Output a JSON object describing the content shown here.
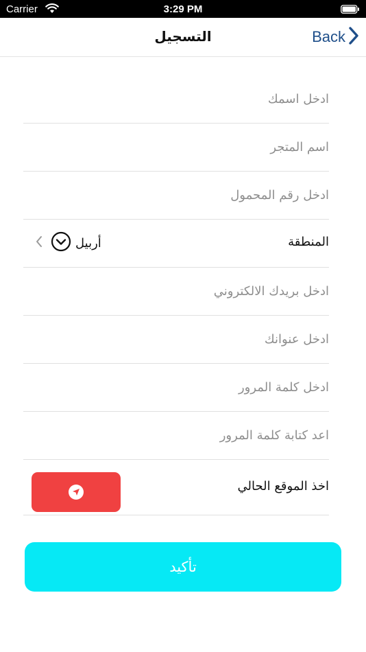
{
  "status_bar": {
    "carrier": "Carrier",
    "time": "3:29 PM",
    "wifi_icon": "wifi-icon",
    "battery_icon": "battery-icon"
  },
  "nav": {
    "title": "التسجيل",
    "back_label": "Back",
    "back_icon": "chevron-right-icon",
    "accent_color": "#1f4f8a"
  },
  "form": {
    "name_placeholder": "ادخل اسمك",
    "store_placeholder": "اسم المتجر",
    "mobile_placeholder": "ادخل رقم المحمول",
    "region": {
      "label": "المنطقة",
      "value": "أربيل",
      "dropdown_icon": "chevron-down-circle-icon",
      "chevron_icon": "chevron-left-icon"
    },
    "email_placeholder": "ادخل بريدك الالكتروني",
    "address_placeholder": "ادخل عنوانك",
    "password_placeholder": "ادخل كلمة المرور",
    "password_confirm_placeholder": "اعد كتابة كلمة المرور",
    "location": {
      "label": "اخذ الموقع الحالي",
      "button_icon": "location-arrow-icon",
      "button_color": "#f04141"
    }
  },
  "confirm": {
    "label": "تأكيد",
    "color": "#06e9f5"
  }
}
